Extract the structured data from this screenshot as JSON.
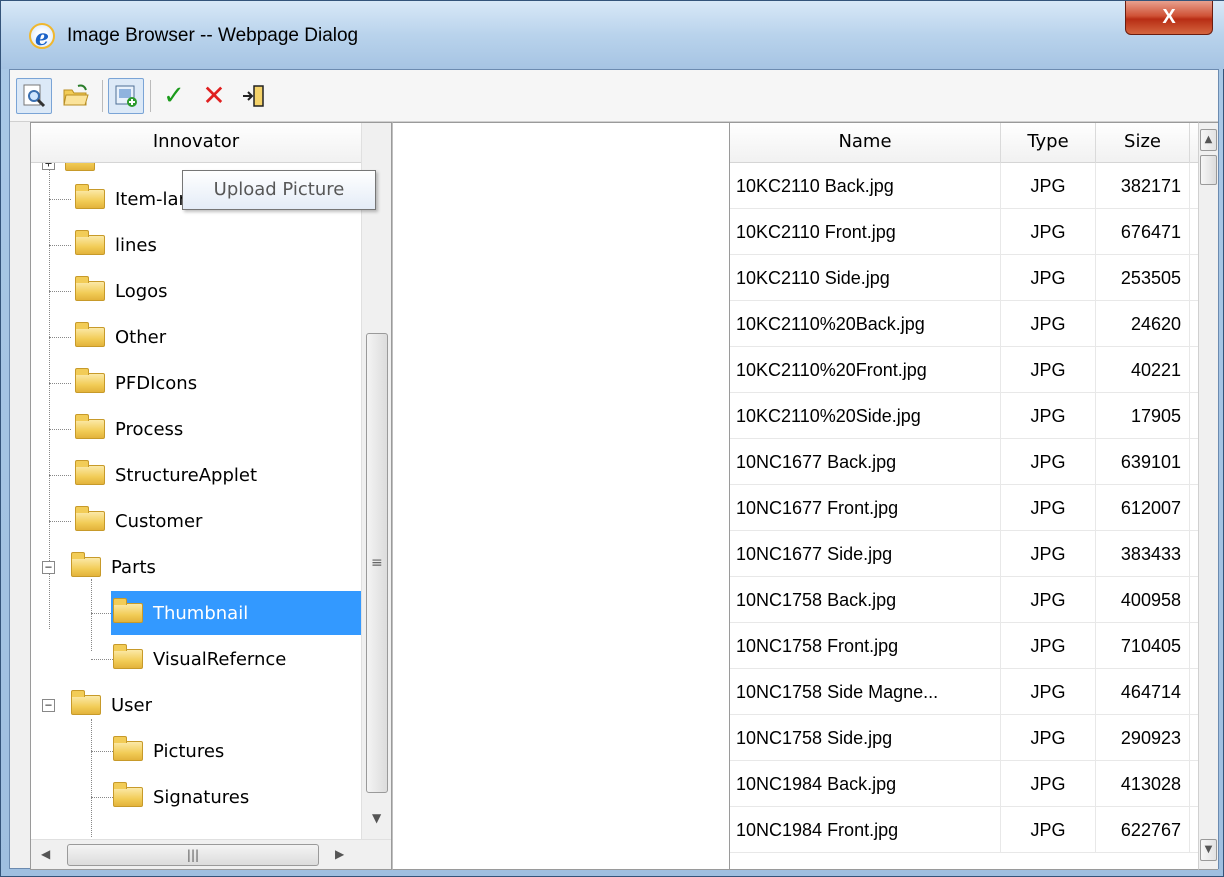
{
  "window": {
    "title": "Image Browser -- Webpage Dialog",
    "close_label": "X"
  },
  "toolbar": {
    "buttons": [
      {
        "name": "preview-button",
        "icon": "magnifier-page-icon"
      },
      {
        "name": "open-folder-button",
        "icon": "open-folder-icon"
      },
      {
        "name": "upload-picture-button",
        "icon": "image-add-icon"
      },
      {
        "name": "ok-button",
        "icon": "checkmark-icon",
        "color": "#1c9b1c"
      },
      {
        "name": "cancel-button",
        "icon": "red-x-icon",
        "color": "#e02020"
      },
      {
        "name": "exit-button",
        "icon": "exit-door-icon"
      }
    ]
  },
  "tooltip": {
    "text": "Upload Picture"
  },
  "tree": {
    "header": "Innovator",
    "items": [
      {
        "label": "Item-large"
      },
      {
        "label": "lines"
      },
      {
        "label": "Logos"
      },
      {
        "label": "Other"
      },
      {
        "label": "PFDIcons"
      },
      {
        "label": "Process"
      },
      {
        "label": "StructureApplet"
      },
      {
        "label": "Customer"
      },
      {
        "label": "Parts"
      },
      {
        "label": "Thumbnail"
      },
      {
        "label": "VisualRefernce"
      },
      {
        "label": "User"
      },
      {
        "label": "Pictures"
      },
      {
        "label": "Signatures"
      }
    ],
    "selected": "Thumbnail",
    "selection_color": "#3399ff"
  },
  "grid": {
    "columns": [
      "Name",
      "Type",
      "Size"
    ],
    "rows": [
      {
        "name": "10KC2110 Back.jpg",
        "type": "JPG",
        "size": "382171"
      },
      {
        "name": "10KC2110 Front.jpg",
        "type": "JPG",
        "size": "676471"
      },
      {
        "name": "10KC2110 Side.jpg",
        "type": "JPG",
        "size": "253505"
      },
      {
        "name": "10KC2110%20Back.jpg",
        "type": "JPG",
        "size": "24620"
      },
      {
        "name": "10KC2110%20Front.jpg",
        "type": "JPG",
        "size": "40221"
      },
      {
        "name": "10KC2110%20Side.jpg",
        "type": "JPG",
        "size": "17905"
      },
      {
        "name": "10NC1677 Back.jpg",
        "type": "JPG",
        "size": "639101"
      },
      {
        "name": "10NC1677 Front.jpg",
        "type": "JPG",
        "size": "612007"
      },
      {
        "name": "10NC1677 Side.jpg",
        "type": "JPG",
        "size": "383433"
      },
      {
        "name": "10NC1758 Back.jpg",
        "type": "JPG",
        "size": "400958"
      },
      {
        "name": "10NC1758 Front.jpg",
        "type": "JPG",
        "size": "710405"
      },
      {
        "name": "10NC1758 Side Magne...",
        "type": "JPG",
        "size": "464714"
      },
      {
        "name": "10NC1758 Side.jpg",
        "type": "JPG",
        "size": "290923"
      },
      {
        "name": "10NC1984 Back.jpg",
        "type": "JPG",
        "size": "413028"
      },
      {
        "name": "10NC1984 Front.jpg",
        "type": "JPG",
        "size": "622767"
      }
    ]
  }
}
